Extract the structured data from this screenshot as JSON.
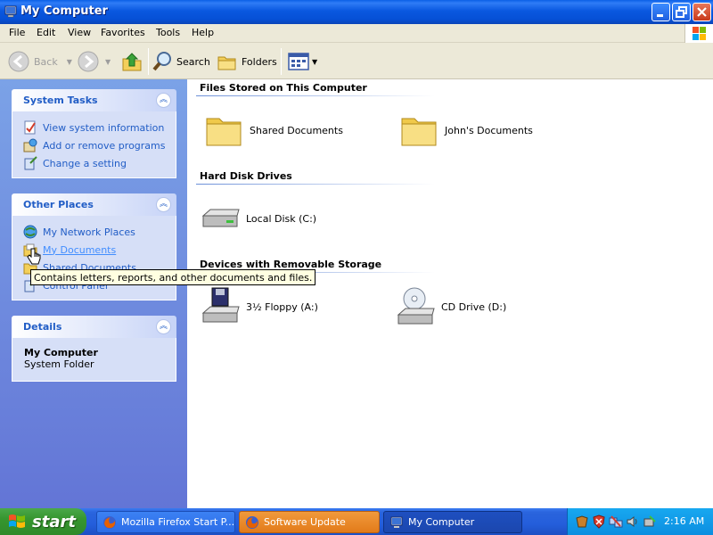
{
  "window": {
    "title": "My Computer"
  },
  "menubar": {
    "items": [
      "File",
      "Edit",
      "View",
      "Favorites",
      "Tools",
      "Help"
    ]
  },
  "toolbar": {
    "back_label": "Back",
    "search_label": "Search",
    "folders_label": "Folders"
  },
  "sidebar": {
    "system_tasks": {
      "title": "System Tasks",
      "items": [
        "View system information",
        "Add or remove programs",
        "Change a setting"
      ]
    },
    "other_places": {
      "title": "Other Places",
      "items": [
        "My Network Places",
        "My Documents",
        "Shared Documents",
        "Control Panel"
      ]
    },
    "details": {
      "title": "Details",
      "name": "My Computer",
      "type": "System Folder"
    }
  },
  "tooltip": {
    "text": "Contains letters, reports, and other documents and files."
  },
  "content": {
    "groups": [
      {
        "title": "Files Stored on This Computer",
        "items": [
          "Shared Documents",
          "John's Documents"
        ]
      },
      {
        "title": "Hard Disk Drives",
        "items": [
          "Local Disk (C:)"
        ]
      },
      {
        "title": "Devices with Removable Storage",
        "items": [
          "3½ Floppy (A:)",
          "CD Drive (D:)"
        ]
      }
    ]
  },
  "taskbar": {
    "start_label": "start",
    "tasks": [
      "Mozilla Firefox Start P...",
      "Software Update",
      "My Computer"
    ],
    "clock": "2:16 AM"
  },
  "colors": {
    "titlebar": "#0a58e0",
    "sidebar_link": "#215dc6",
    "start_button": "#36962f",
    "flash_task": "#e27b1a"
  }
}
